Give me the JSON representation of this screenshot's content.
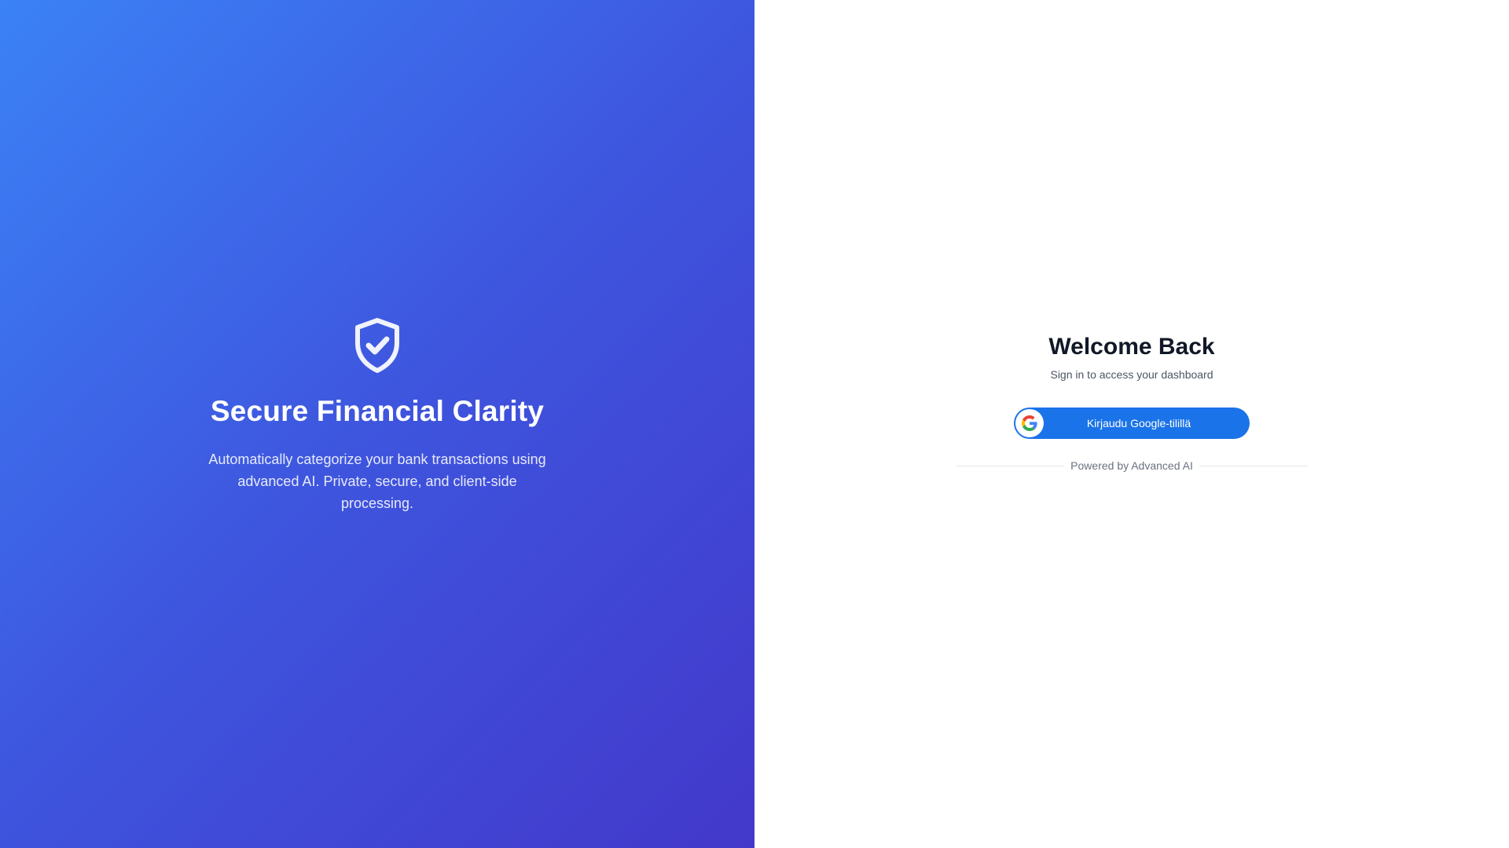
{
  "hero": {
    "icon": "shield-check-icon",
    "title": "Secure Financial Clarity",
    "description": "Automatically categorize your bank transactions using advanced AI. Private, secure, and client-side processing."
  },
  "login": {
    "title": "Welcome Back",
    "subtitle": "Sign in to access your dashboard",
    "google_button_label": "Kirjaudu Google-tilillä",
    "google_icon": "google-icon",
    "footer_text": "Powered by Advanced AI"
  },
  "colors": {
    "hero_gradient_start": "#3b82f6",
    "hero_gradient_end": "#4338ca",
    "google_button": "#1a73e8",
    "title_text": "#111827"
  }
}
